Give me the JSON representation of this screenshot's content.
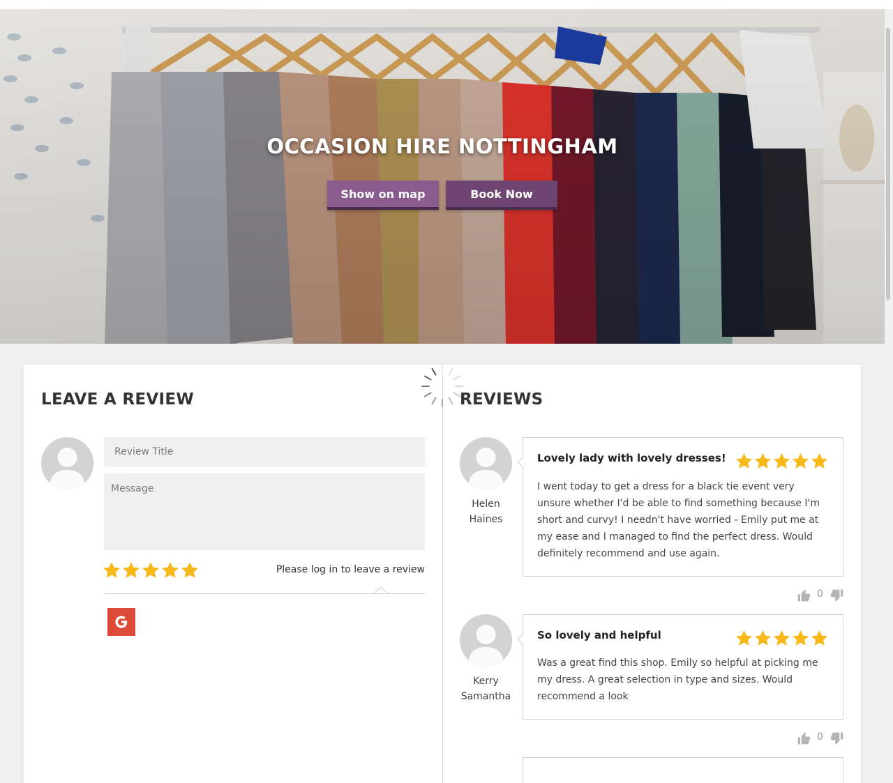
{
  "hero": {
    "title": "OCCASION HIRE NOTTINGHAM",
    "show_map_label": "Show on map",
    "book_now_label": "Book Now"
  },
  "colors": {
    "brand_purple": "#8a5b8f",
    "brand_purple_dark": "#6e4571",
    "star": "#f7b81a",
    "google_red": "#dc4a38"
  },
  "leave_review": {
    "heading": "LEAVE A REVIEW",
    "title_placeholder": "Review Title",
    "message_placeholder": "Message",
    "rating": 5,
    "login_note": "Please log in to leave a review",
    "login_icon": "google-icon"
  },
  "reviews": {
    "heading": "REVIEWS",
    "items": [
      {
        "author_first": "Helen",
        "author_last": "Haines",
        "title": "Lovely lady with lovely dresses!",
        "rating": 5,
        "body": "I went today to get a dress for a black tie event very unsure whether I'd be able to find something because I'm short and curvy! I needn't have worried - Emily put me at my ease and I managed to find the perfect dress. Would definitely recommend and use again.",
        "votes": "0"
      },
      {
        "author_first": "Kerry",
        "author_last": "Samantha",
        "title": "So lovely and helpful",
        "rating": 5,
        "body": "Was a great find this shop. Emily so helpful at picking me my dress. A great selection in type and sizes. Would recommend a look",
        "votes": "0"
      }
    ]
  }
}
